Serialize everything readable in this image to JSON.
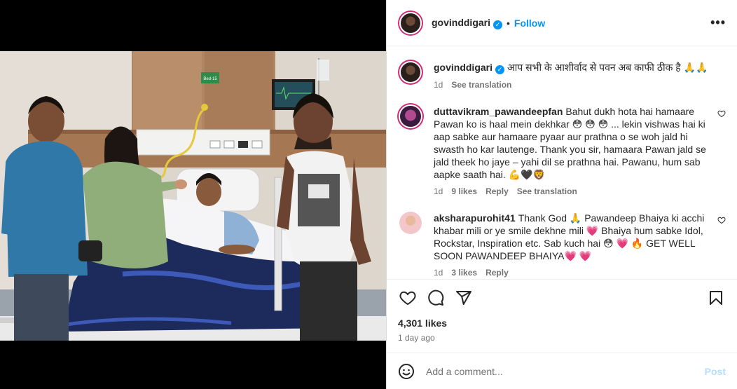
{
  "header": {
    "username": "govinddigari",
    "separator": "•",
    "follow_label": "Follow",
    "more_label": "•••"
  },
  "caption": {
    "username": "govinddigari",
    "text": "आप सभी के आशीर्वाद से पवन अब काफी ठीक है 🙏🙏",
    "time": "1d",
    "see_translation": "See translation"
  },
  "comments": [
    {
      "username": "duttavikram_pawandeepfan",
      "text": "Bahut dukh hota hai hamaare Pawan ko is haal mein dekhkar 😳 😳 😳 ... lekin vishwas hai ki aap sabke aur hamaare pyaar aur prathna o se woh jald hi swasth ho kar lautenge. Thank you sir, hamaara Pawan jald se jald theek ho jaye – yahi dil se prathna hai. Pawanu, hum sab aapke saath hai. 💪🖤🦁",
      "time": "1d",
      "likes": "9 likes",
      "reply": "Reply",
      "see_translation": "See translation"
    },
    {
      "username": "aksharapurohit41",
      "text": "Thank God 🙏 Pawandeep Bhaiya ki acchi khabar mili or ye smile dekhne mili 💗 Bhaiya hum sabke Idol, Rockstar, Inspiration etc. Sab kuch hai 😳 💗 🔥 GET WELL SOON PAWANDEEP BHAIYA💗 💗",
      "time": "1d",
      "likes": "3 likes",
      "reply": "Reply"
    }
  ],
  "post": {
    "likes": "4,301 likes",
    "date": "1 day ago"
  },
  "add_comment": {
    "placeholder": "Add a comment...",
    "post_label": "Post"
  },
  "photo": {
    "bed_label": "Bed-15"
  },
  "icons": {
    "like": "heart-icon",
    "comment": "comment-icon",
    "share": "share-icon",
    "save": "bookmark-icon",
    "emoji": "emoji-icon"
  },
  "colors": {
    "accent": "#0095f6",
    "verified": "#0095f6",
    "post_disabled": "#b2dffc",
    "muted": "#737373"
  }
}
